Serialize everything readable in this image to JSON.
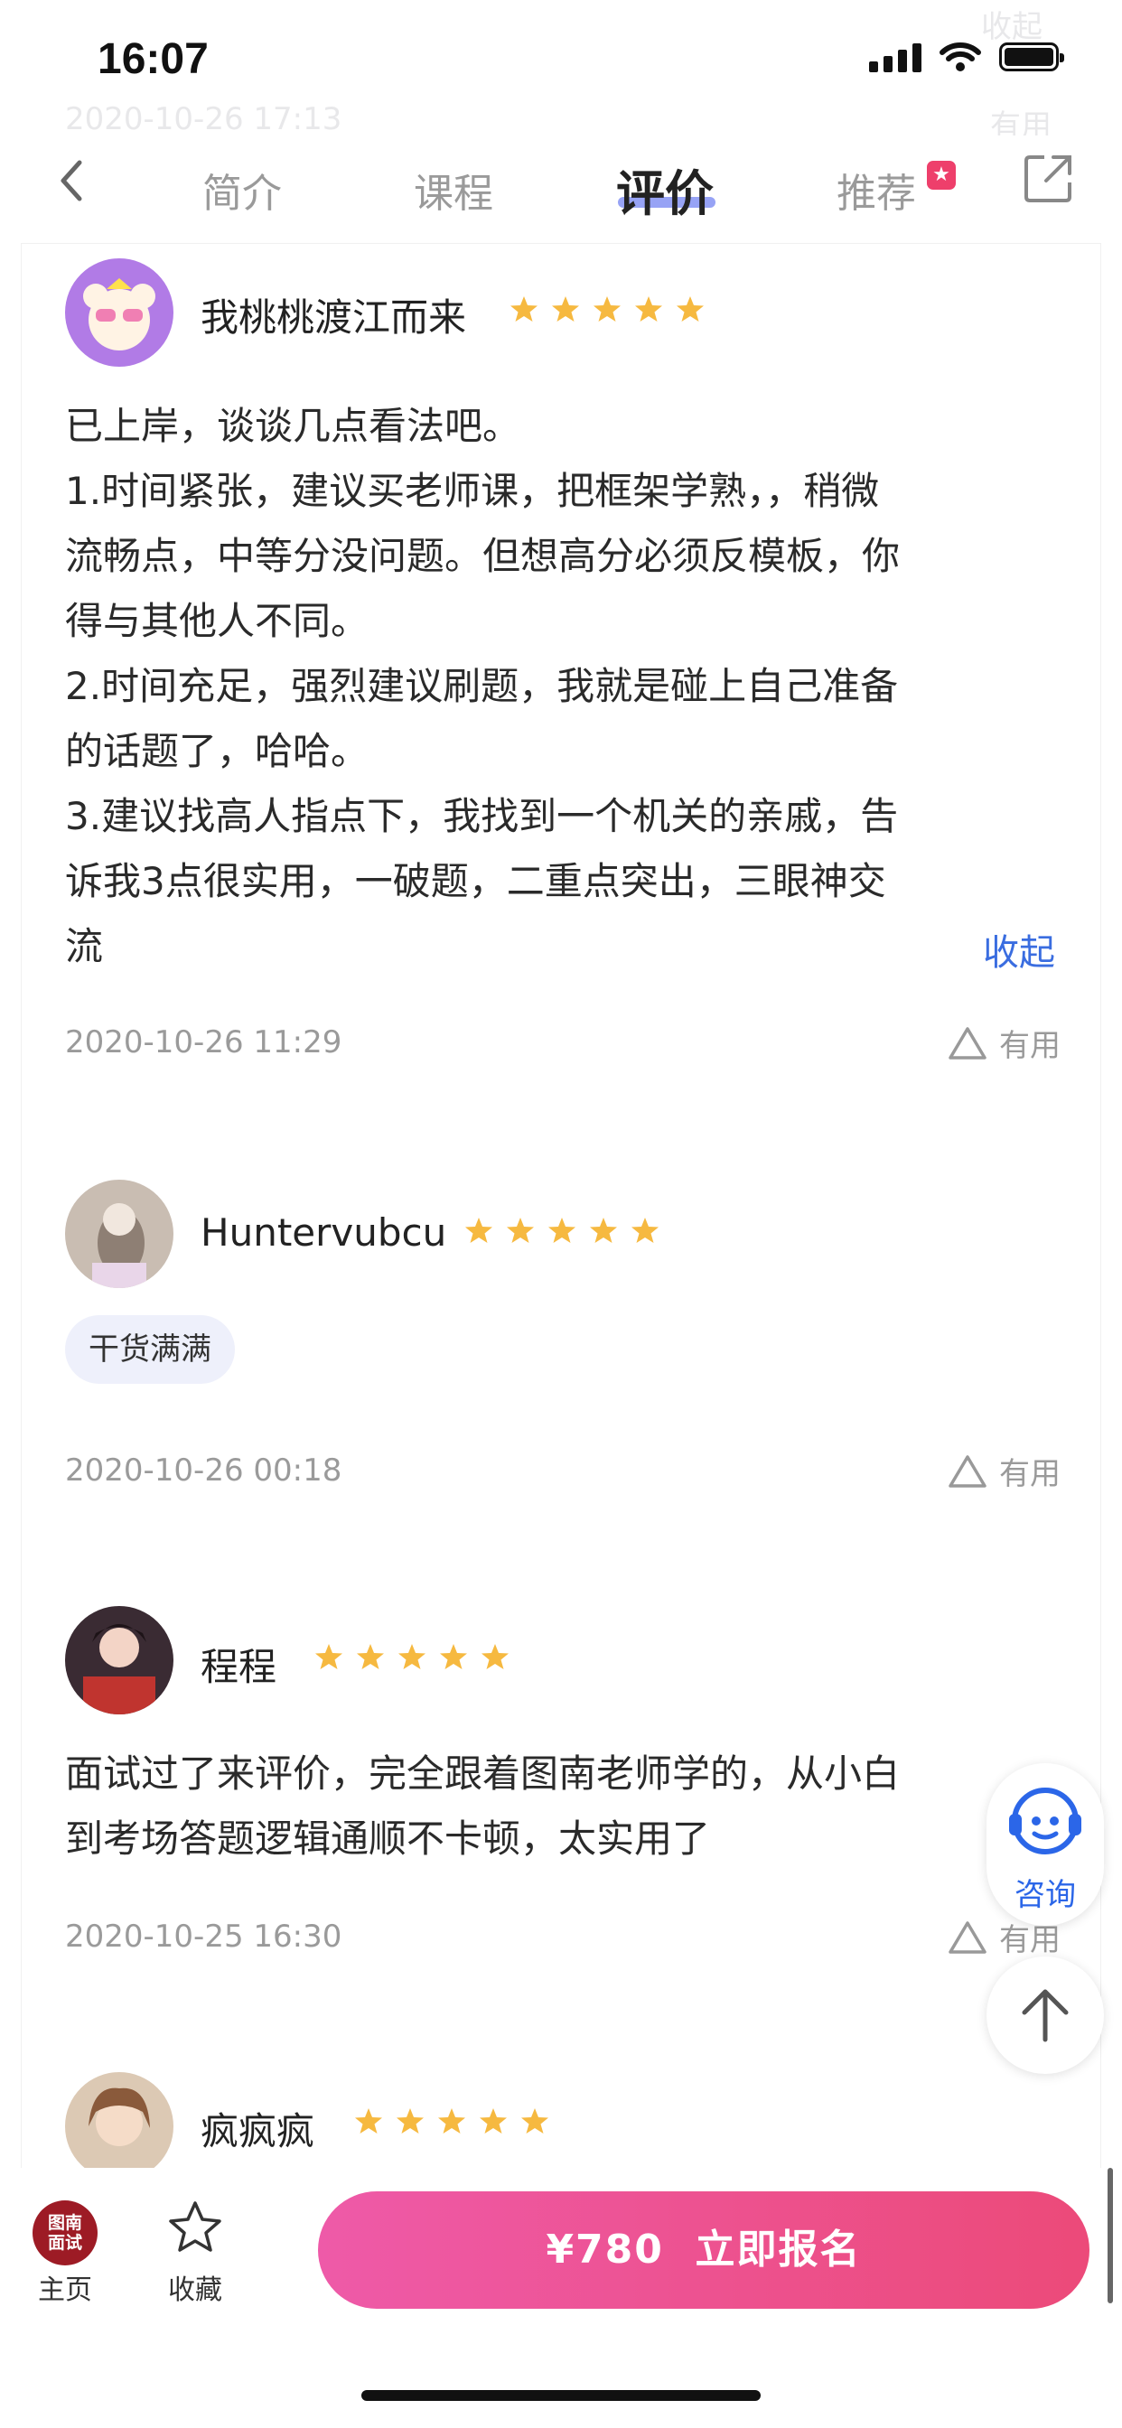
{
  "status_bar": {
    "time": "16:07"
  },
  "ghost": {
    "collapse": "收起",
    "date": "2020-10-26 17:13",
    "useful": "有用"
  },
  "nav": {
    "tabs": [
      {
        "label": "简介"
      },
      {
        "label": "课程"
      },
      {
        "label": "评价",
        "active": true
      },
      {
        "label": "推荐",
        "badge": "★"
      }
    ]
  },
  "reviews": [
    {
      "name": "我桃桃渡江而来",
      "stars": 5,
      "text": [
        "已上岸，谈谈几点看法吧。",
        "1.时间紧张，建议买老师课，把框架学熟，，稍微",
        "流畅点，中等分没问题。但想高分必须反模板，你",
        "得与其他人不同。",
        "2.时间充足，强烈建议刷题，我就是碰上自己准备",
        "的话题了，哈哈。",
        "3.建议找高人指点下，我找到一个机关的亲戚，告",
        "诉我3点很实用，一破题，二重点突出，三眼神交",
        "流"
      ],
      "collapse": "收起",
      "date": "2020-10-26 11:29",
      "useful": "有用"
    },
    {
      "name": "Huntervubcu",
      "stars": 5,
      "tag": "干货满满",
      "date": "2020-10-26 00:18",
      "useful": "有用"
    },
    {
      "name": "程程",
      "stars": 5,
      "text": [
        "面试过了来评价，完全跟着图南老师学的，从小白",
        "到考场答题逻辑通顺不卡顿，太实用了"
      ],
      "date": "2020-10-25 16:30",
      "useful": "有用"
    },
    {
      "name": "疯疯疯",
      "stars": 5
    }
  ],
  "floating": {
    "consult": "咨询"
  },
  "bottom_bar": {
    "home_logo": "图南\n面试",
    "home_label": "主页",
    "fav_label": "收藏",
    "buy_label": "¥780  立即报名"
  },
  "colors": {
    "accent": "#3a6de0",
    "star": "#f6b940",
    "button_from": "#ee5aa8",
    "button_to": "#ec4a79"
  }
}
